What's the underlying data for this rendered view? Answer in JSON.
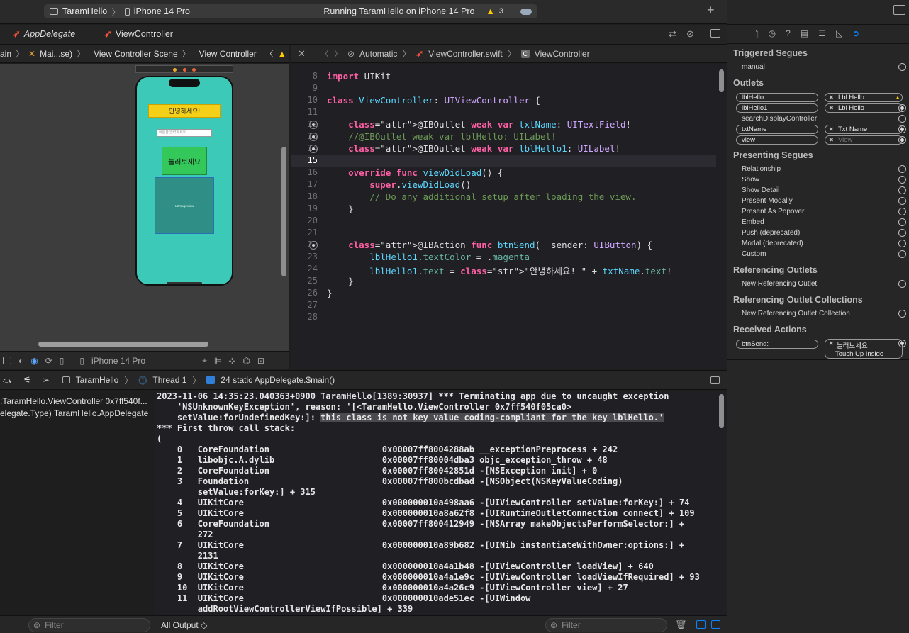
{
  "titlebar": {
    "scheme": "TaramHello",
    "device": "iPhone 14 Pro",
    "status": "Running TaramHello on iPhone 14 Pro",
    "warnings": "3"
  },
  "tabs": [
    {
      "label": "AppDelegate"
    },
    {
      "label": "ViewController"
    }
  ],
  "jump_left": {
    "items": [
      "ain",
      "Mai...se)",
      "View Controller Scene",
      "View Controller"
    ]
  },
  "jump_right": {
    "items": [
      "Automatic",
      "ViewController.swift",
      "ViewController"
    ]
  },
  "storyboard": {
    "label_text": "안녕하세요!",
    "textfield_placeholder": "이름을 입력하세요",
    "button_text": "눌러보세요",
    "image_label": "UIImageView"
  },
  "canvas_bar": {
    "device": "iPhone 14 Pro"
  },
  "editor": {
    "current_line": "15",
    "lines": [
      {
        "n": "8",
        "code": "import UIKit"
      },
      {
        "n": "9",
        "code": ""
      },
      {
        "n": "10",
        "code": "class ViewController: UIViewController {"
      },
      {
        "n": "11",
        "code": ""
      },
      {
        "n": "12",
        "code": "    @IBOutlet weak var txtName: UITextField!"
      },
      {
        "n": "13",
        "code": "    //@IBOutlet weak var lblHello: UILabel!"
      },
      {
        "n": "14",
        "code": "    @IBOutlet weak var lblHello1: UILabel!"
      },
      {
        "n": "15",
        "code": ""
      },
      {
        "n": "16",
        "code": "    override func viewDidLoad() {"
      },
      {
        "n": "17",
        "code": "        super.viewDidLoad()"
      },
      {
        "n": "18",
        "code": "        // Do any additional setup after loading the view."
      },
      {
        "n": "19",
        "code": "    }"
      },
      {
        "n": "20",
        "code": ""
      },
      {
        "n": "21",
        "code": ""
      },
      {
        "n": "22",
        "code": "    @IBAction func btnSend(_ sender: UIButton) {"
      },
      {
        "n": "23",
        "code": "        lblHello1.textColor = .magenta"
      },
      {
        "n": "24",
        "code": "        lblHello1.text = \"안녕하세요! \" + txtName.text!"
      },
      {
        "n": "25",
        "code": "    }"
      },
      {
        "n": "26",
        "code": "}"
      },
      {
        "n": "27",
        "code": ""
      },
      {
        "n": "28",
        "code": ""
      }
    ]
  },
  "debug_bar": {
    "app": "TaramHello",
    "thread": "Thread 1",
    "frame": "24 static AppDelegate.$main()"
  },
  "variables": [
    ":TaramHello.ViewController 0x7ff540f...",
    "elegate.Type) TaramHello.AppDelegate"
  ],
  "console": {
    "lines": [
      "2023-11-06 14:35:23.040363+0900 TaramHello[1389:30937] *** Terminating app due to uncaught exception",
      "    'NSUnknownKeyException', reason: '[<TaramHello.ViewController 0x7ff540f05ca0>",
      "    setValue:forUndefinedKey:]: ",
      "*** First throw call stack:",
      "(",
      "    0   CoreFoundation                      0x00007ff8004288ab __exceptionPreprocess + 242",
      "    1   libobjc.A.dylib                     0x00007ff80004dba3 objc_exception_throw + 48",
      "    2   CoreFoundation                      0x00007ff80042851d -[NSException init] + 0",
      "    3   Foundation                          0x00007ff800bcdbad -[NSObject(NSKeyValueCoding)",
      "        setValue:forKey:] + 315",
      "    4   UIKitCore                           0x000000010a498aa6 -[UIViewController setValue:forKey:] + 74",
      "    5   UIKitCore                           0x000000010a8a62f8 -[UIRuntimeOutletConnection connect] + 109",
      "    6   CoreFoundation                      0x00007ff800412949 -[NSArray makeObjectsPerformSelector:] +",
      "        272",
      "    7   UIKitCore                           0x000000010a89b682 -[UINib instantiateWithOwner:options:] +",
      "        2131",
      "    8   UIKitCore                           0x000000010a4a1b48 -[UIViewController loadView] + 640",
      "    9   UIKitCore                           0x000000010a4a1e9c -[UIViewController loadViewIfRequired] + 93",
      "    10  UIKitCore                           0x000000010a4a26c9 -[UIViewController view] + 27",
      "    11  UIKitCore                           0x000000010ade51ec -[UIWindow",
      "        addRootViewControllerViewIfPossible] + 339"
    ],
    "highlight": "this class is not key value coding-compliant for the key lblHello.'"
  },
  "filter_bar": {
    "left_placeholder": "Filter",
    "output_select": "All Output ◇",
    "right_placeholder": "Filter"
  },
  "inspector": {
    "sections": {
      "triggered_segues": "Triggered Segues",
      "outlets": "Outlets",
      "presenting_segues": "Presenting Segues",
      "referencing_outlets": "Referencing Outlets",
      "referencing_outlet_collections": "Referencing Outlet Collections",
      "received_actions": "Received Actions"
    },
    "triggered": [
      "manual"
    ],
    "outlets": [
      {
        "name": "lblHello",
        "target": "Lbl Hello"
      },
      {
        "name": "lblHello1",
        "target": "Lbl Hello"
      },
      {
        "name": "searchDisplayController",
        "target": ""
      },
      {
        "name": "txtName",
        "target": "Txt Name"
      },
      {
        "name": "view",
        "target": "View"
      }
    ],
    "presenting": [
      "Relationship",
      "Show",
      "Show Detail",
      "Present Modally",
      "Present As Popover",
      "Embed",
      "Push (deprecated)",
      "Modal (deprecated)",
      "Custom"
    ],
    "ref_outlet": "New Referencing Outlet",
    "ref_collection": "New Referencing Outlet Collection",
    "action": {
      "name": "btnSend:",
      "target": "눌러보세요",
      "event": "Touch Up Inside"
    }
  },
  "colors": {
    "phone_bg": "#3dc9b8",
    "label_bg": "#f5d019",
    "button_bg": "#34c759",
    "warning": "#ffcc00",
    "accent": "#0a84ff"
  }
}
